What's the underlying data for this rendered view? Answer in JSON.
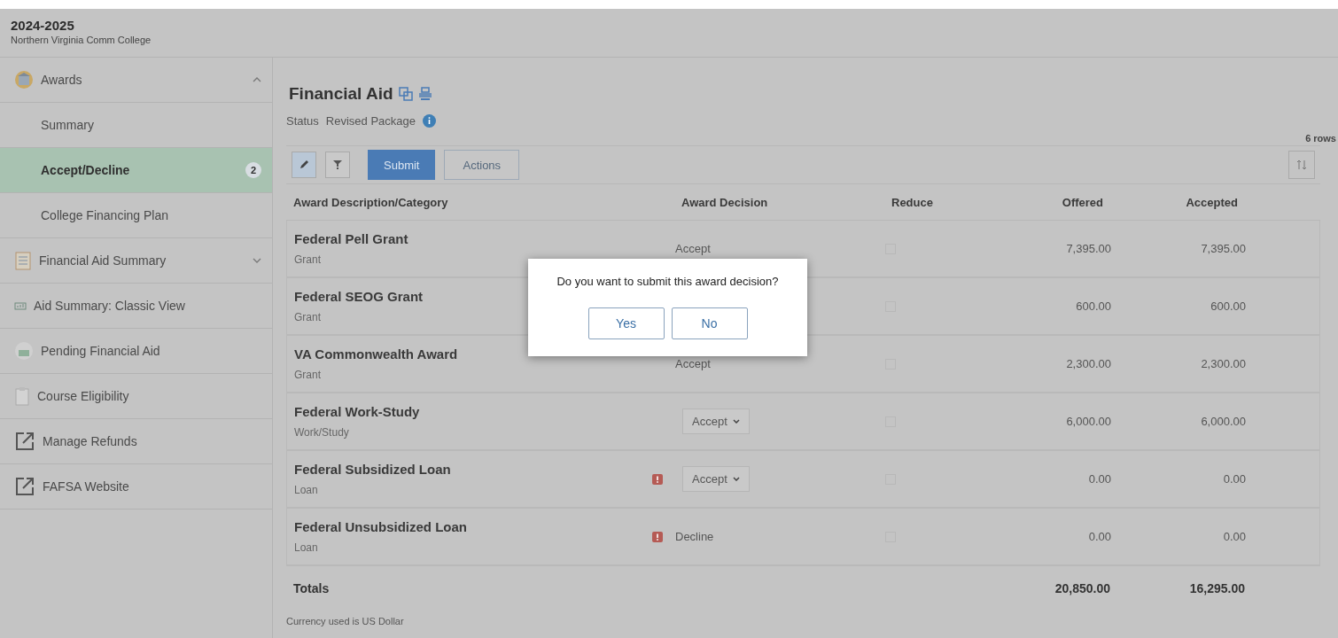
{
  "header": {
    "year": "2024-2025",
    "school": "Northern Virginia Comm College"
  },
  "sidebar": {
    "items": [
      {
        "kind": "section",
        "label": "Awards",
        "expanded": true,
        "selected": false
      },
      {
        "kind": "subitem",
        "label": "Summary",
        "selected": false
      },
      {
        "kind": "subitem",
        "label": "Accept/Decline",
        "selected": true,
        "badge": "2"
      },
      {
        "kind": "subitem",
        "label": "College Financing Plan",
        "selected": false
      },
      {
        "kind": "section",
        "label": "Financial Aid Summary",
        "expanded": false,
        "selected": false
      },
      {
        "kind": "link",
        "label": "Aid Summary: Classic View",
        "selected": false
      },
      {
        "kind": "link",
        "label": "Pending Financial Aid",
        "selected": false
      },
      {
        "kind": "link",
        "label": "Course Eligibility",
        "selected": false
      },
      {
        "kind": "external",
        "label": "Manage Refunds",
        "selected": false
      },
      {
        "kind": "external",
        "label": "FAFSA Website",
        "selected": false
      }
    ]
  },
  "main": {
    "title": "Financial Aid",
    "status_label": "Status",
    "status_value": "Revised Package",
    "row_count": "6 rows",
    "toolbar": {
      "submit": "Submit",
      "actions": "Actions"
    },
    "table": {
      "columns": [
        "Award Description/Category",
        "Award Decision",
        "Reduce",
        "Offered",
        "Accepted"
      ],
      "rows": [
        {
          "name": "Federal Pell Grant",
          "category": "Grant",
          "decision": {
            "kind": "text",
            "value": "Accept"
          },
          "warning": false,
          "reduce_checked": false,
          "offered": "7,395.00",
          "accepted": "7,395.00"
        },
        {
          "name": "Federal SEOG Grant",
          "category": "Grant",
          "decision": {
            "kind": "hidden"
          },
          "warning": false,
          "reduce_checked": false,
          "offered": "600.00",
          "accepted": "600.00"
        },
        {
          "name": "VA Commonwealth Award",
          "category": "Grant",
          "decision": {
            "kind": "text",
            "value": "Accept"
          },
          "warning": false,
          "reduce_checked": false,
          "offered": "2,300.00",
          "accepted": "2,300.00"
        },
        {
          "name": "Federal Work-Study",
          "category": "Work/Study",
          "decision": {
            "kind": "select",
            "value": "Accept"
          },
          "warning": false,
          "reduce_checked": false,
          "offered": "6,000.00",
          "accepted": "6,000.00"
        },
        {
          "name": "Federal Subsidized Loan",
          "category": "Loan",
          "decision": {
            "kind": "select",
            "value": "Accept"
          },
          "warning": true,
          "reduce_checked": false,
          "offered": "0.00",
          "accepted": "0.00"
        },
        {
          "name": "Federal Unsubsidized Loan",
          "category": "Loan",
          "decision": {
            "kind": "text",
            "value": "Decline"
          },
          "warning": true,
          "reduce_checked": false,
          "offered": "0.00",
          "accepted": "0.00"
        }
      ],
      "totals": {
        "label": "Totals",
        "offered": "20,850.00",
        "accepted": "16,295.00"
      }
    },
    "footnote": "Currency used is US Dollar"
  },
  "dialog": {
    "message": "Do you want to submit this award decision?",
    "buttons": [
      "Yes",
      "No"
    ]
  }
}
